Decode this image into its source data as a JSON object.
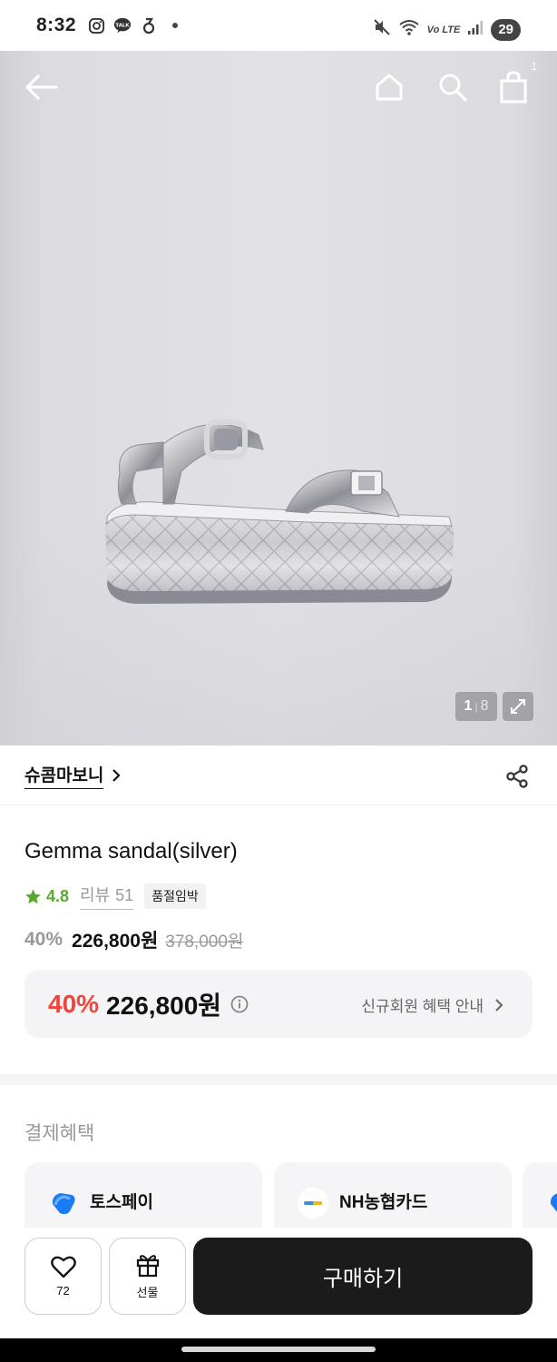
{
  "status_bar": {
    "time": "8:32",
    "left_icons": [
      "instagram-icon",
      "talk-icon",
      "app-icon",
      "dot-icon"
    ],
    "right_icons": [
      "mute-icon",
      "wifi-icon",
      "volte-icon",
      "signal-icon"
    ],
    "volte_label": "Vo LTE",
    "battery": "29"
  },
  "header": {
    "cart_count": "1"
  },
  "gallery": {
    "current": "1",
    "separator": "|",
    "total": "8"
  },
  "brand": {
    "name": "슈콤마보니"
  },
  "product": {
    "title": "Gemma sandal(silver)",
    "rating": "4.8",
    "review_label": "리뷰",
    "review_count": "51",
    "stock_badge": "품절임박",
    "discount": "40%",
    "price": "226,800원",
    "original_price": "378,000원"
  },
  "member_benefit": {
    "discount": "40%",
    "price": "226,800원",
    "link_label": "신규회원 혜택 안내"
  },
  "payment": {
    "section_title": "결제혜택",
    "cards": [
      {
        "name": "토스페이",
        "icon": "toss-pay-icon"
      },
      {
        "name": "NH농협카드",
        "icon": "nh-card-icon"
      }
    ]
  },
  "bottom_bar": {
    "like_count": "72",
    "gift_label": "선물",
    "buy_label": "구매하기"
  },
  "colors": {
    "accent_red": "#f0443c",
    "rating_green": "#5aa92c",
    "buy_button": "#1b1b1b"
  }
}
